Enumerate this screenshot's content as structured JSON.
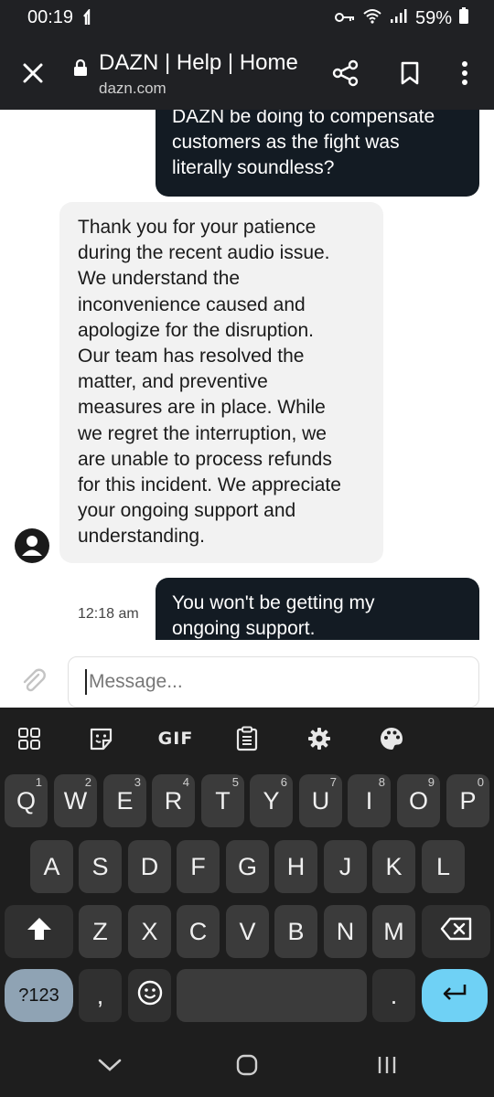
{
  "status_bar": {
    "time": "00:19",
    "battery": "59%"
  },
  "browser": {
    "title": "DAZN | Help | Home",
    "url": "dazn.com"
  },
  "chat": {
    "messages": [
      {
        "lines": [
          "DAZN be doing to compensate",
          "customers as the fight was",
          "literally soundless?"
        ]
      },
      {
        "lines": [
          "Thank you for your patience",
          "during the recent audio issue.",
          "We understand the",
          "inconvenience caused and",
          "apologize for the disruption.",
          "Our team has resolved the",
          "matter, and preventive",
          "measures are in place. While",
          "we regret the interruption, we",
          "are unable to process refunds",
          "for this incident. We appreciate",
          "your ongoing support and",
          "understanding."
        ]
      },
      {
        "lines": [
          "You won't be getting my",
          "ongoing support."
        ],
        "time": "12:18 am"
      }
    ]
  },
  "composer": {
    "placeholder": "Message..."
  },
  "keyboard": {
    "gif_label": "GIF",
    "row1": [
      {
        "k": "Q",
        "n": "1"
      },
      {
        "k": "W",
        "n": "2"
      },
      {
        "k": "E",
        "n": "3"
      },
      {
        "k": "R",
        "n": "4"
      },
      {
        "k": "T",
        "n": "5"
      },
      {
        "k": "Y",
        "n": "6"
      },
      {
        "k": "U",
        "n": "7"
      },
      {
        "k": "I",
        "n": "8"
      },
      {
        "k": "O",
        "n": "9"
      },
      {
        "k": "P",
        "n": "0"
      }
    ],
    "row2": [
      "A",
      "S",
      "D",
      "F",
      "G",
      "H",
      "J",
      "K",
      "L"
    ],
    "row3": [
      "Z",
      "X",
      "C",
      "V",
      "B",
      "N",
      "M"
    ],
    "sym_label": "?123",
    "comma": ",",
    "period": "."
  }
}
